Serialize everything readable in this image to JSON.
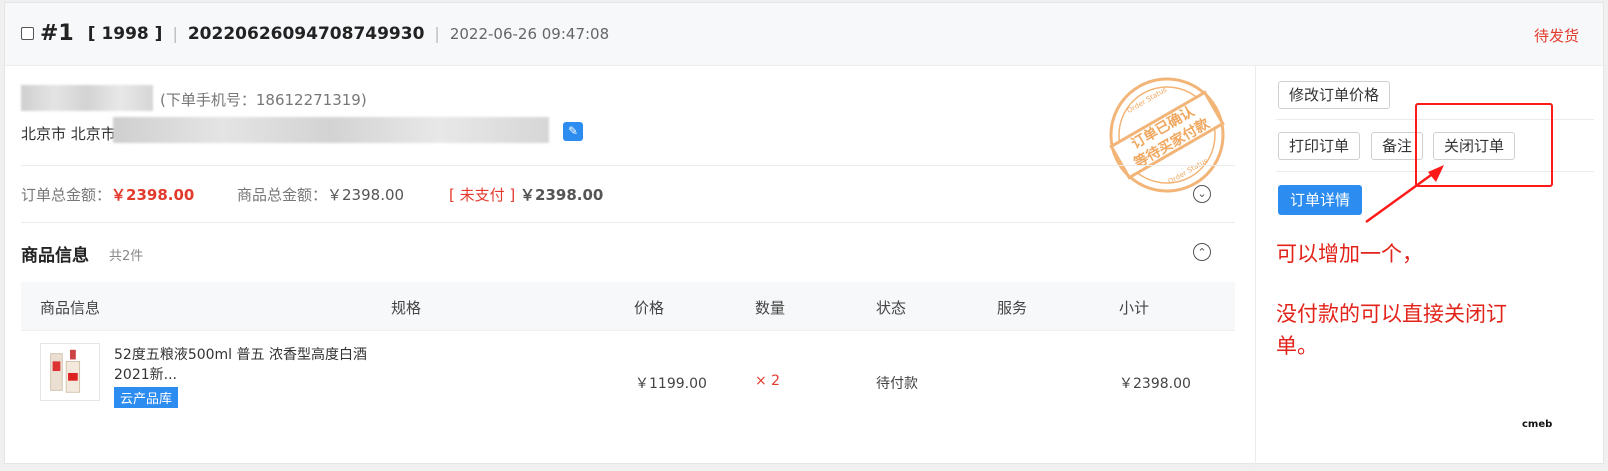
{
  "order": {
    "index": "#1",
    "year": "[ 1998 ]",
    "number": "20220626094708749930",
    "datetime": "2022-06-26 09:47:08",
    "status": "待发货"
  },
  "customer": {
    "phone_label": "(下单手机号：18612271319)",
    "address_prefix": "北京市 北京市"
  },
  "stamp": {
    "text": "订单已确认 等待买家付款",
    "small_top": "Order Status",
    "small_bottom": "Order Status"
  },
  "amounts": {
    "total_label": "订单总金额：",
    "total_value": "￥2398.00",
    "goods_label": "商品总金额：",
    "goods_value": "￥2398.00",
    "unpaid_tag": "[ 未支付 ]",
    "unpaid_value": "￥2398.00"
  },
  "goods": {
    "title": "商品信息",
    "count": "共2件",
    "columns": [
      "商品信息",
      "规格",
      "价格",
      "数量",
      "状态",
      "服务",
      "小计"
    ],
    "rows": [
      {
        "name": "52度五粮液500ml 普五 浓香型高度白酒 2021新...",
        "tag": "云产品库",
        "price": "￥1199.00",
        "qty": "× 2",
        "status": "待付款",
        "service": "",
        "subtotal": "￥2398.00"
      }
    ]
  },
  "actions": {
    "modify_price": "修改订单价格",
    "print": "打印订单",
    "note": "备注",
    "close": "关闭订单",
    "detail": "订单详情"
  },
  "annotation": {
    "line1": "可以增加一个，",
    "line2": "没付款的可以直接关闭订",
    "line3": "单。"
  },
  "logo": "cmeb",
  "colors": {
    "accent_red": "#e23b2e",
    "primary_blue": "#2d8cf0",
    "annotation_red": "#e2231a"
  }
}
